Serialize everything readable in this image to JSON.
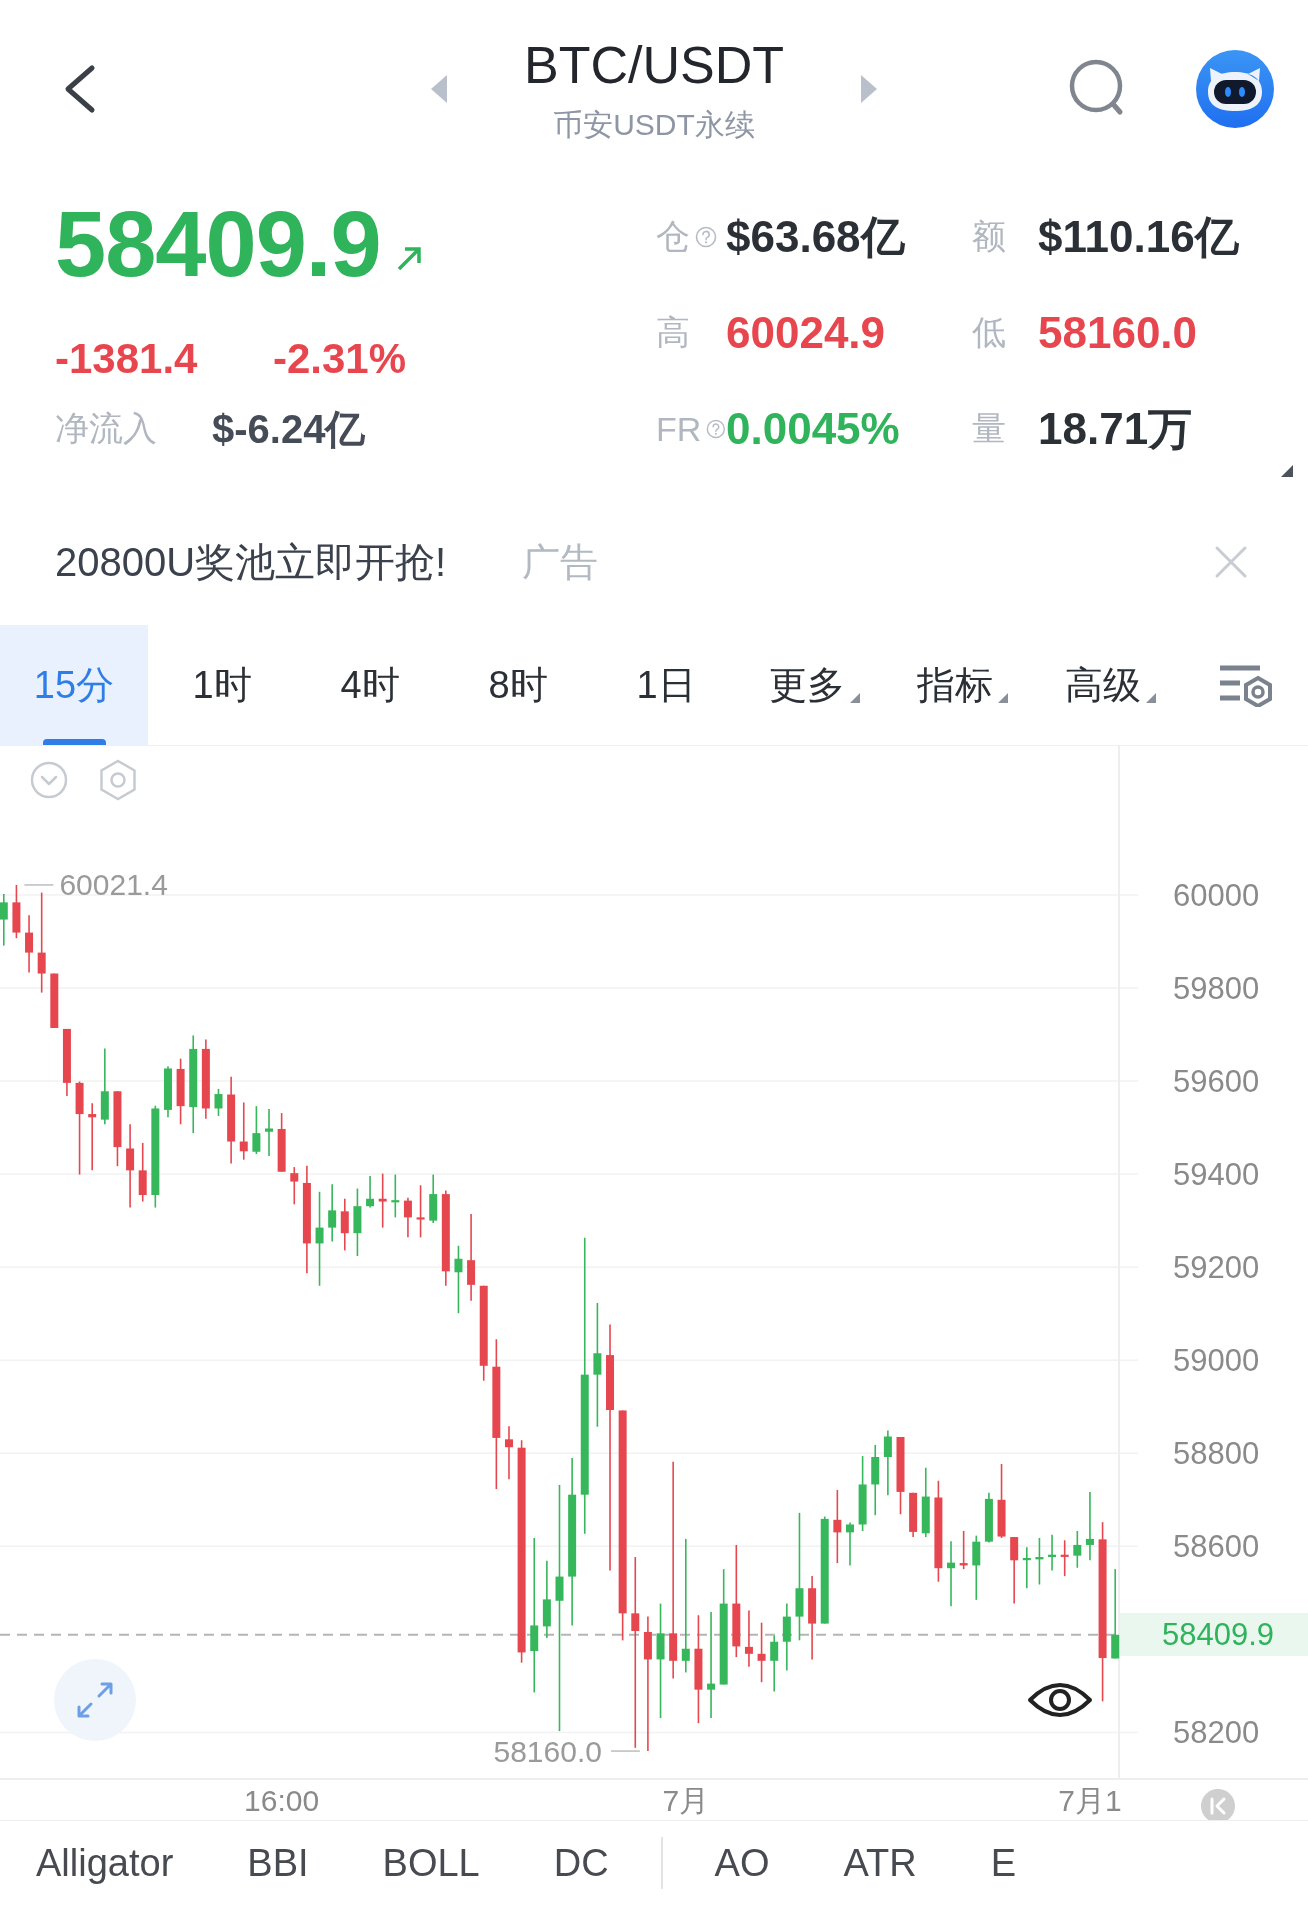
{
  "header": {
    "title": "BTC/USDT",
    "subtitle": "币安USDT永续"
  },
  "ticker": {
    "price": {
      "value": "58409.9",
      "up": true
    },
    "change": {
      "value": "-1381.4",
      "percent": "-2.31%",
      "up": false
    },
    "net_inflow": {
      "label": "净流入",
      "value": "$-6.24亿"
    },
    "stats": [
      {
        "label": "仓",
        "info": true,
        "value": "$63.68亿",
        "color": "#2b2f36"
      },
      {
        "label": "额",
        "info": false,
        "value": "$110.16亿",
        "color": "#2b2f36"
      },
      {
        "label": "高",
        "info": false,
        "value": "60024.9",
        "color": "#e8464e"
      },
      {
        "label": "低",
        "info": false,
        "value": "58160.0",
        "color": "#e8464e"
      },
      {
        "label": "FR",
        "info": true,
        "value": "0.0045%",
        "color": "#2fb35b"
      },
      {
        "label": "量",
        "info": false,
        "value": "18.71万",
        "color": "#2b2f36"
      }
    ]
  },
  "ad": {
    "text": "20800U奖池立即开抢!",
    "tag": "广告"
  },
  "periods": [
    {
      "label": "15分",
      "selected": true,
      "dropdown": false
    },
    {
      "label": "1时",
      "selected": false,
      "dropdown": false
    },
    {
      "label": "4时",
      "selected": false,
      "dropdown": false
    },
    {
      "label": "8时",
      "selected": false,
      "dropdown": false
    },
    {
      "label": "1日",
      "selected": false,
      "dropdown": false
    },
    {
      "label": "更多",
      "selected": false,
      "dropdown": true
    },
    {
      "label": "指标",
      "selected": false,
      "dropdown": true
    },
    {
      "label": "高级",
      "selected": false,
      "dropdown": true
    }
  ],
  "chart": {
    "high_label": "60021.4",
    "low_label": "58160.0",
    "chart_data": {
      "type": "candlestick",
      "categories": [
        null,
        null,
        null,
        null,
        null,
        null,
        null,
        null,
        null,
        null,
        null,
        null,
        null,
        null,
        null,
        null,
        null,
        null,
        null,
        null,
        null,
        null,
        "16:00",
        null,
        null,
        null,
        null,
        null,
        null,
        null,
        null,
        null,
        null,
        null,
        null,
        null,
        null,
        null,
        null,
        null,
        null,
        null,
        null,
        null,
        null,
        null,
        null,
        null,
        null,
        null,
        null,
        null,
        null,
        null,
        "7月",
        null,
        null,
        null,
        null,
        null,
        null,
        null,
        null,
        null,
        null,
        null,
        null,
        null,
        null,
        null,
        null,
        null,
        null,
        null,
        null,
        null,
        null,
        null,
        null,
        null,
        null,
        null,
        null,
        null,
        null,
        null,
        "7月1",
        null,
        null
      ],
      "ohlc": [
        [
          59947,
          60002,
          59891,
          59984
        ],
        [
          59984,
          60021.4,
          59907,
          59919
        ],
        [
          59919,
          59956,
          59833,
          59876
        ],
        [
          59876,
          60005,
          59790,
          59831
        ],
        [
          59831,
          59831,
          59714,
          59714
        ],
        [
          59712,
          59712,
          59568,
          59596
        ],
        [
          59596,
          59599,
          59399,
          59529
        ],
        [
          59529,
          59552,
          59408,
          59522
        ],
        [
          59517,
          59670,
          59507,
          59578
        ],
        [
          59578,
          59578,
          59417,
          59458
        ],
        [
          59455,
          59507,
          59328,
          59408
        ],
        [
          59408,
          59467,
          59341,
          59355
        ],
        [
          59355,
          59547,
          59328,
          59541
        ],
        [
          59538,
          59632,
          59522,
          59627
        ],
        [
          59626,
          59648,
          59507,
          59546
        ],
        [
          59544,
          59698,
          59488,
          59669
        ],
        [
          59669,
          59689,
          59519,
          59541
        ],
        [
          59541,
          59583,
          59525,
          59572
        ],
        [
          59571,
          59609,
          59423,
          59470
        ],
        [
          59470,
          59554,
          59431,
          59449
        ],
        [
          59448,
          59546,
          59443,
          59488
        ],
        [
          59491,
          59540,
          59439,
          59498
        ],
        [
          59497,
          59531,
          59405,
          59405
        ],
        [
          59402,
          59415,
          59335,
          59384
        ],
        [
          59381,
          59418,
          59187,
          59251
        ],
        [
          59251,
          59362,
          59160,
          59285
        ],
        [
          59285,
          59378,
          59255,
          59322
        ],
        [
          59320,
          59347,
          59236,
          59273
        ],
        [
          59273,
          59369,
          59224,
          59331
        ],
        [
          59331,
          59396,
          59328,
          59347
        ],
        [
          59347,
          59401,
          59285,
          59341
        ],
        [
          59341,
          59399,
          59307,
          59344
        ],
        [
          59343,
          59349,
          59264,
          59307
        ],
        [
          59307,
          59376,
          59264,
          59303
        ],
        [
          59300,
          59399,
          59295,
          59357
        ],
        [
          59357,
          59365,
          59160,
          59191
        ],
        [
          59189,
          59246,
          59101,
          59218
        ],
        [
          59215,
          59314,
          59128,
          59162
        ],
        [
          59160,
          59160,
          58956,
          58988
        ],
        [
          58986,
          59045,
          58723,
          58833
        ],
        [
          58830,
          58858,
          58744,
          58813
        ],
        [
          58812,
          58828,
          58350,
          58372
        ],
        [
          58375,
          58618,
          58286,
          58430
        ],
        [
          58428,
          58569,
          58403,
          58486
        ],
        [
          58483,
          58732,
          58203,
          58535
        ],
        [
          58535,
          58790,
          58430,
          58711
        ],
        [
          58711,
          59263,
          58627,
          58969
        ],
        [
          58969,
          59123,
          58857,
          59015
        ],
        [
          59011,
          59077,
          58548,
          58893
        ],
        [
          58892,
          58892,
          58398,
          58456
        ],
        [
          58456,
          58577,
          58167,
          58418
        ],
        [
          58416,
          58449,
          58160,
          58357
        ],
        [
          58357,
          58477,
          58231,
          58413
        ],
        [
          58413,
          58782,
          58316,
          58354
        ],
        [
          58354,
          58616,
          58329,
          58380
        ],
        [
          58380,
          58452,
          58220,
          58292
        ],
        [
          58292,
          58459,
          58231,
          58305
        ],
        [
          58303,
          58551,
          58303,
          58477
        ],
        [
          58477,
          58603,
          58362,
          58385
        ],
        [
          58384,
          58462,
          58341,
          58369
        ],
        [
          58369,
          58436,
          58308,
          58354
        ],
        [
          58354,
          58408,
          58288,
          58395
        ],
        [
          58395,
          58477,
          58333,
          58449
        ],
        [
          58449,
          58672,
          58398,
          58510
        ],
        [
          58510,
          58536,
          58357,
          58434
        ],
        [
          58434,
          58664,
          58434,
          58659
        ],
        [
          58657,
          58721,
          58564,
          58630
        ],
        [
          58630,
          58651,
          58559,
          58647
        ],
        [
          58647,
          58794,
          58633,
          58733
        ],
        [
          58733,
          58818,
          58667,
          58792
        ],
        [
          58792,
          58849,
          58710,
          58836
        ],
        [
          58835,
          58835,
          58669,
          58717
        ],
        [
          58715,
          58715,
          58620,
          58631
        ],
        [
          58628,
          58769,
          58620,
          58707
        ],
        [
          58705,
          58741,
          58524,
          58553
        ],
        [
          58553,
          58611,
          58471,
          58565
        ],
        [
          58564,
          58633,
          58551,
          58559
        ],
        [
          58559,
          58623,
          58485,
          58610
        ],
        [
          58610,
          58715,
          58608,
          58702
        ],
        [
          58700,
          58777,
          58618,
          58621
        ],
        [
          58620,
          58620,
          58477,
          58570
        ],
        [
          58571,
          58598,
          58510,
          58575
        ],
        [
          58572,
          58618,
          58518,
          58577
        ],
        [
          58577,
          58625,
          58548,
          58582
        ],
        [
          58582,
          58613,
          58536,
          58578
        ],
        [
          58580,
          58633,
          58554,
          58603
        ],
        [
          58603,
          58717,
          58570,
          58616
        ],
        [
          58615,
          58652,
          58267,
          58360
        ],
        [
          58359,
          58551,
          58359,
          58409.9
        ]
      ],
      "ylim": [
        58100,
        60320
      ],
      "yticks": [
        58200,
        58600,
        58800,
        59000,
        59200,
        59400,
        59600,
        59800,
        60000
      ],
      "grid": true,
      "ref_lines": [
        {
          "axis": "y",
          "value": 58409.9,
          "label": "58409.9"
        }
      ]
    }
  },
  "indicator_groups": [
    {
      "items": [
        "Alligator",
        "BBI",
        "BOLL",
        "DC"
      ]
    },
    {
      "items": [
        "AO",
        "ATR",
        "E"
      ]
    }
  ]
}
